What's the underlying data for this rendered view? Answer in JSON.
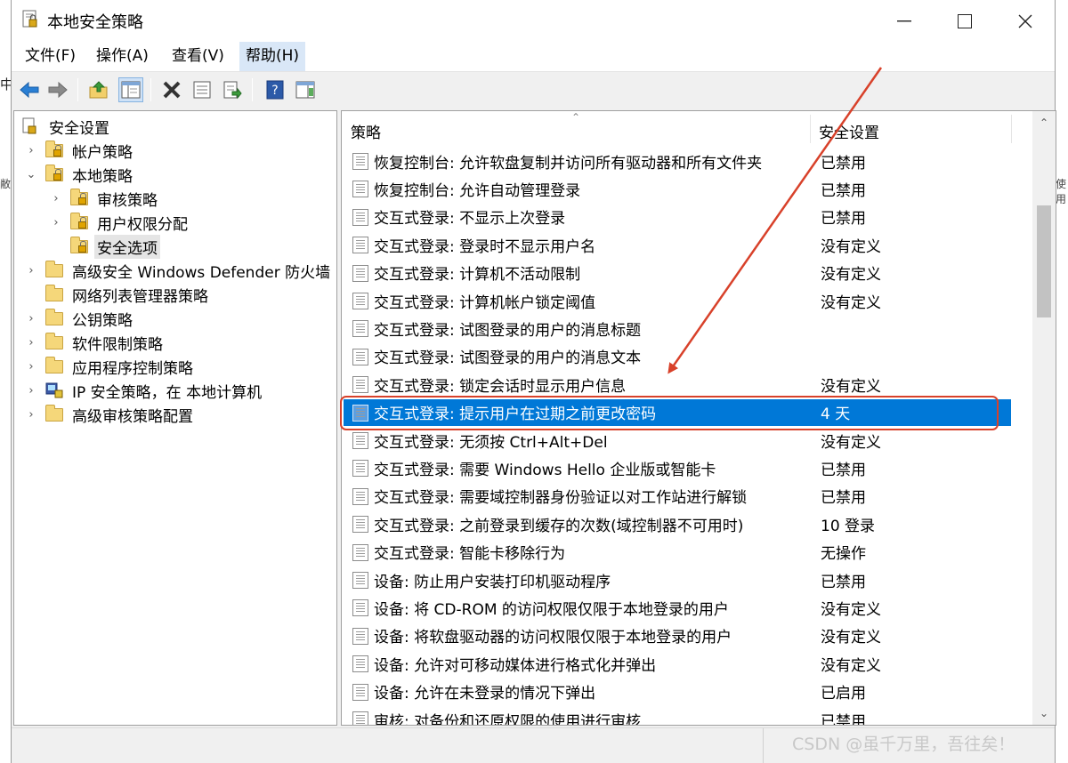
{
  "window": {
    "title": "本地安全策略"
  },
  "background": {
    "left_fragment": "中",
    "left_fragment2": "敝",
    "right_fragment": "使用"
  },
  "menu": [
    {
      "label": "文件(F)",
      "active": false
    },
    {
      "label": "操作(A)",
      "active": false
    },
    {
      "label": "查看(V)",
      "active": false
    },
    {
      "label": "帮助(H)",
      "active": true
    }
  ],
  "toolbar": [
    "back-icon",
    "forward-icon",
    "up-folder-icon",
    "show-hide-tree-icon",
    "delete-icon",
    "properties-icon",
    "export-list-icon",
    "help-icon",
    "show-action-pane-icon"
  ],
  "tree": [
    {
      "label": "安全设置",
      "level": 0,
      "arrow": "",
      "icon": "security-settings-icon"
    },
    {
      "label": "帐户策略",
      "level": 1,
      "arrow": "›",
      "icon": "folder-lock-icon"
    },
    {
      "label": "本地策略",
      "level": 1,
      "arrow": "⌄",
      "icon": "folder-lock-icon"
    },
    {
      "label": "审核策略",
      "level": 2,
      "arrow": "›",
      "icon": "folder-lock-icon"
    },
    {
      "label": "用户权限分配",
      "level": 2,
      "arrow": "›",
      "icon": "folder-lock-icon"
    },
    {
      "label": "安全选项",
      "level": 2,
      "arrow": "",
      "icon": "folder-lock-icon",
      "selected": true
    },
    {
      "label": "高级安全 Windows Defender 防火墙",
      "level": 1,
      "arrow": "›",
      "icon": "folder-icon"
    },
    {
      "label": "网络列表管理器策略",
      "level": 1,
      "arrow": "",
      "icon": "folder-icon"
    },
    {
      "label": "公钥策略",
      "level": 1,
      "arrow": "›",
      "icon": "folder-icon"
    },
    {
      "label": "软件限制策略",
      "level": 1,
      "arrow": "›",
      "icon": "folder-icon"
    },
    {
      "label": "应用程序控制策略",
      "level": 1,
      "arrow": "›",
      "icon": "folder-icon"
    },
    {
      "label": "IP 安全策略，在 本地计算机",
      "level": 1,
      "arrow": "›",
      "icon": "ip-security-icon"
    },
    {
      "label": "高级审核策略配置",
      "level": 1,
      "arrow": "›",
      "icon": "folder-icon"
    }
  ],
  "list": {
    "columns": {
      "policy": "策略",
      "setting": "安全设置"
    },
    "rows": [
      {
        "policy": "恢复控制台: 允许软盘复制并访问所有驱动器和所有文件夹",
        "setting": "已禁用"
      },
      {
        "policy": "恢复控制台: 允许自动管理登录",
        "setting": "已禁用"
      },
      {
        "policy": "交互式登录: 不显示上次登录",
        "setting": "已禁用"
      },
      {
        "policy": "交互式登录: 登录时不显示用户名",
        "setting": "没有定义"
      },
      {
        "policy": "交互式登录: 计算机不活动限制",
        "setting": "没有定义"
      },
      {
        "policy": "交互式登录: 计算机帐户锁定阈值",
        "setting": "没有定义"
      },
      {
        "policy": "交互式登录: 试图登录的用户的消息标题",
        "setting": ""
      },
      {
        "policy": "交互式登录: 试图登录的用户的消息文本",
        "setting": ""
      },
      {
        "policy": "交互式登录: 锁定会话时显示用户信息",
        "setting": "没有定义"
      },
      {
        "policy": "交互式登录: 提示用户在过期之前更改密码",
        "setting": "4 天",
        "selected": true
      },
      {
        "policy": "交互式登录: 无须按 Ctrl+Alt+Del",
        "setting": "没有定义"
      },
      {
        "policy": "交互式登录: 需要 Windows Hello 企业版或智能卡",
        "setting": "已禁用"
      },
      {
        "policy": "交互式登录: 需要域控制器身份验证以对工作站进行解锁",
        "setting": "已禁用"
      },
      {
        "policy": "交互式登录: 之前登录到缓存的次数(域控制器不可用时)",
        "setting": "10 登录"
      },
      {
        "policy": "交互式登录: 智能卡移除行为",
        "setting": "无操作"
      },
      {
        "policy": "设备: 防止用户安装打印机驱动程序",
        "setting": "已禁用"
      },
      {
        "policy": "设备: 将 CD-ROM 的访问权限仅限于本地登录的用户",
        "setting": "没有定义"
      },
      {
        "policy": "设备: 将软盘驱动器的访问权限仅限于本地登录的用户",
        "setting": "没有定义"
      },
      {
        "policy": "设备: 允许对可移动媒体进行格式化并弹出",
        "setting": "没有定义"
      },
      {
        "policy": "设备: 允许在未登录的情况下弹出",
        "setting": "已启用"
      },
      {
        "policy": "审核: 对备份和还原权限的使用进行审核",
        "setting": "已禁用"
      }
    ]
  },
  "watermark": "CSDN @虽千万里，吾往矣！",
  "colors": {
    "selection": "#0078d7",
    "annotation": "#d8412a",
    "menu_active": "#d9e7f7"
  }
}
